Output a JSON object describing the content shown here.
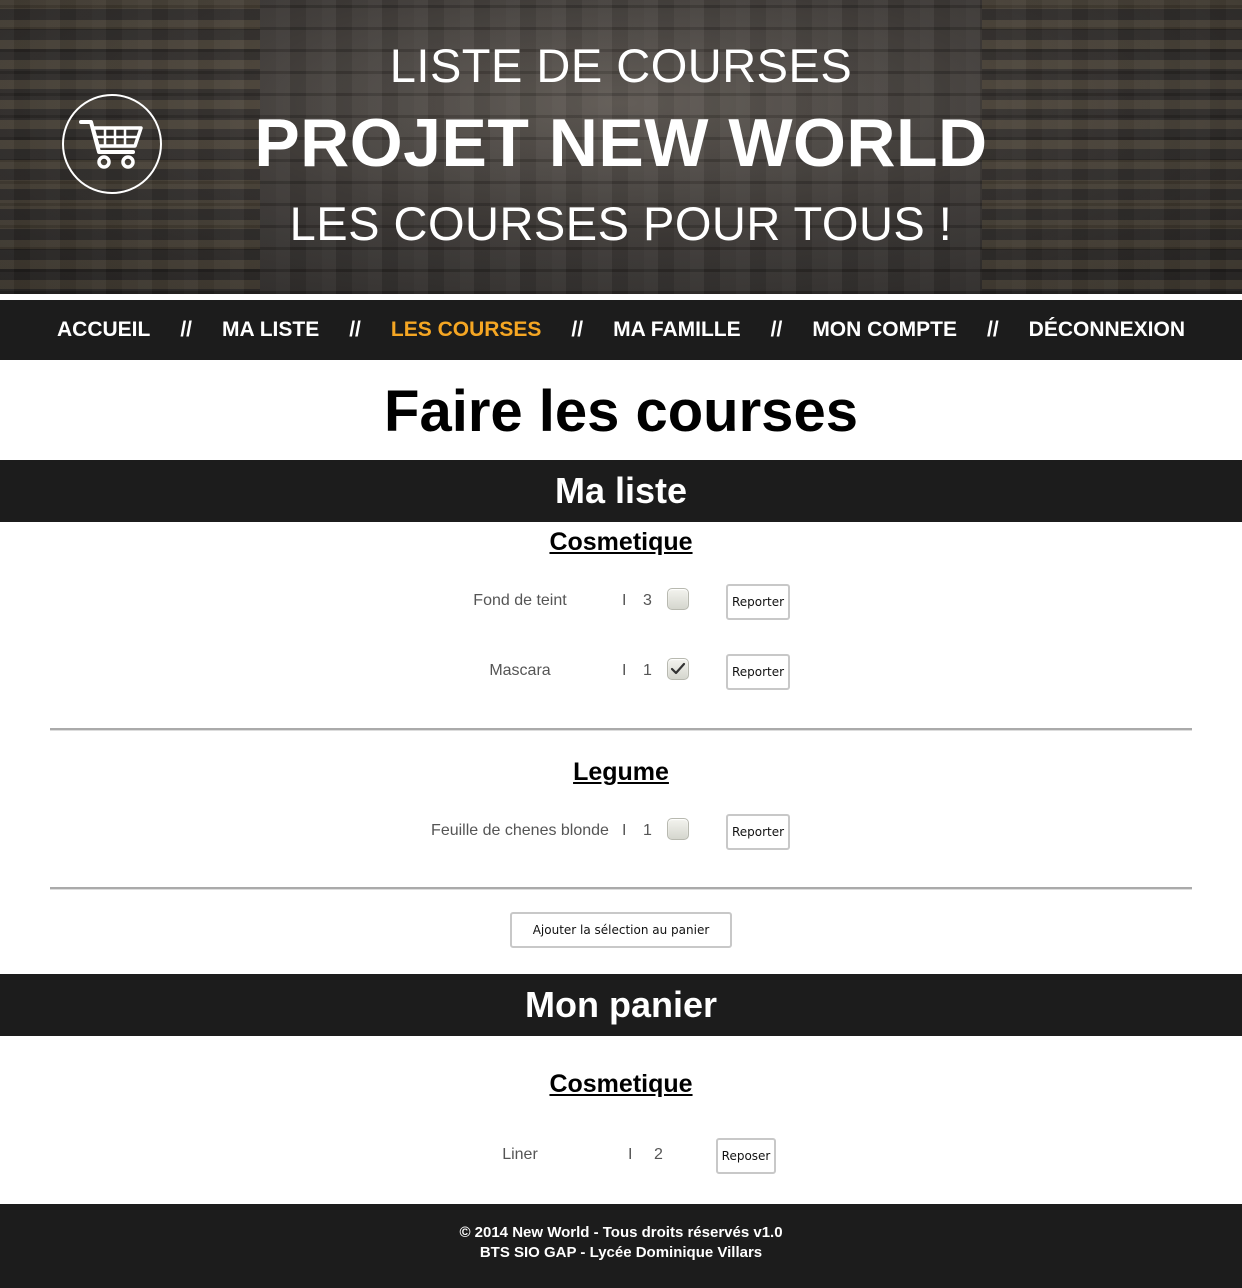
{
  "header": {
    "line1": "LISTE DE COURSES",
    "line2": "PROJET NEW WORLD",
    "line3": "LES COURSES POUR TOUS !",
    "logo_icon": "shopping-cart-icon"
  },
  "nav": {
    "items": [
      {
        "label": "ACCUEIL"
      },
      {
        "label": "MA LISTE"
      },
      {
        "label": "LES COURSES"
      },
      {
        "label": "MA FAMILLE"
      },
      {
        "label": "MON COMPTE"
      },
      {
        "label": "DÉCONNEXION"
      }
    ],
    "separator": "//",
    "active_label": "LES COURSES",
    "active_color": "#f5a623"
  },
  "page_title": "Faire les courses",
  "ma_liste": {
    "title": "Ma liste",
    "categories": [
      {
        "name": "Cosmetique",
        "items": [
          {
            "name": "Fond de teint",
            "pipe": "I",
            "qty": "3",
            "checked": false,
            "button": "Reporter"
          },
          {
            "name": "Mascara",
            "pipe": "I",
            "qty": "1",
            "checked": true,
            "button": "Reporter"
          }
        ]
      },
      {
        "name": "Legume",
        "items": [
          {
            "name": "Feuille de chenes blonde",
            "pipe": "I",
            "qty": "1",
            "checked": false,
            "button": "Reporter"
          }
        ]
      }
    ],
    "add_button": "Ajouter la sélection au panier"
  },
  "panier": {
    "title": "Mon panier",
    "categories": [
      {
        "name": "Cosmetique",
        "items": [
          {
            "name": "Liner",
            "pipe": "I",
            "qty": "2",
            "button": "Reposer"
          }
        ]
      }
    ]
  },
  "footer": {
    "line1": "© 2014 New World - Tous droits réservés v1.0",
    "line2": "BTS SIO GAP - Lycée Dominique Villars"
  }
}
